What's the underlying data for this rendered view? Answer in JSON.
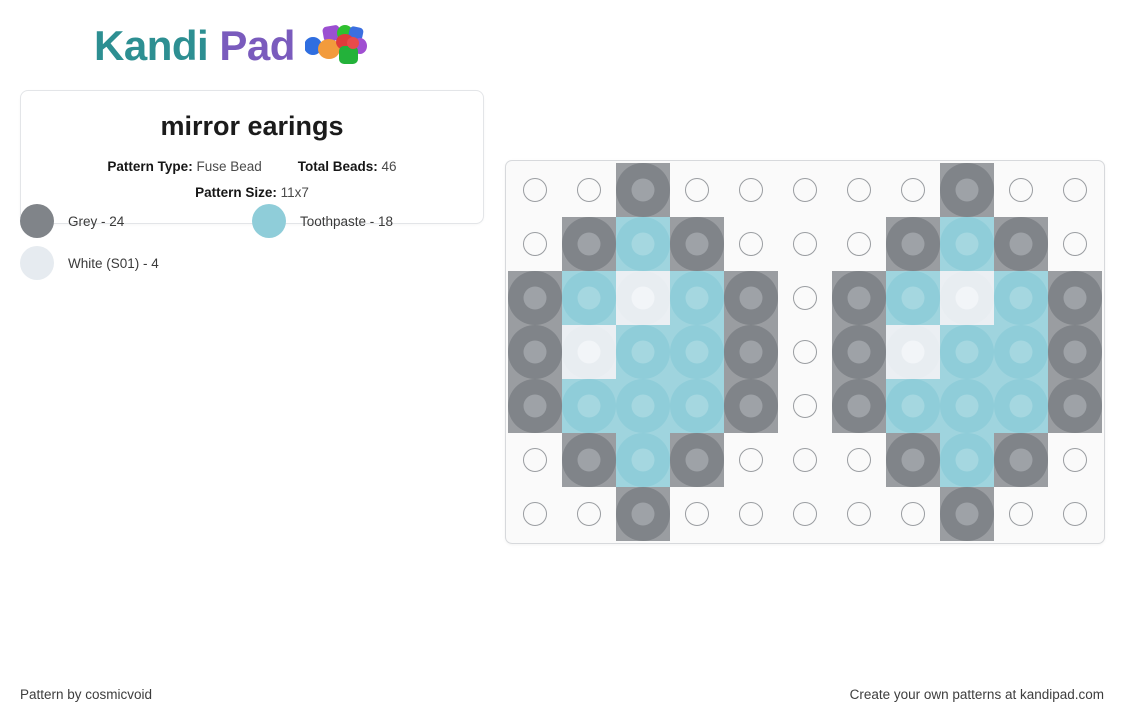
{
  "brand": {
    "name_part1": "Kandi",
    "name_part2": "Pad",
    "beads_icon": "kandi-beads-icon",
    "color_teal": "#2d8f92",
    "color_purple": "#7a5bbd"
  },
  "pattern": {
    "title": "mirror earings",
    "type_label": "Pattern Type:",
    "type_value": "Fuse Bead",
    "total_label": "Total Beads:",
    "total_value": "46",
    "size_label": "Pattern Size:",
    "size_value": "11x7"
  },
  "legend": {
    "items": [
      {
        "name": "Grey",
        "count": 24,
        "label": "Grey - 24",
        "color": "#808489"
      },
      {
        "name": "Toothpaste",
        "count": 18,
        "label": "Toothpaste - 18",
        "color": "#8fcdd9"
      },
      {
        "name": "White (S01)",
        "count": 4,
        "label": "White (S01) - 4",
        "color": "#e6ebf0"
      }
    ]
  },
  "grid": {
    "columns": 11,
    "rows": 7,
    "palette": {
      "G": {
        "key": "G",
        "name": "Grey",
        "fill": "#808489",
        "hole": "#9ea2a7",
        "tint": "#9a9da1"
      },
      "T": {
        "key": "T",
        "name": "Toothpaste",
        "fill": "#8fcdd9",
        "hole": "#a5d7e0",
        "tint": "#9fd4de"
      },
      "W": {
        "key": "W",
        "name": "White (S01)",
        "fill": "#e8edf1",
        "hole": "#f2f5f8",
        "tint": "#ebeff3"
      },
      "_": {
        "key": "_",
        "name": "empty",
        "fill": null,
        "hole": null,
        "tint": null
      }
    },
    "cells": [
      [
        "_",
        "_",
        "G",
        "_",
        "_",
        "_",
        "_",
        "_",
        "G",
        "_",
        "_"
      ],
      [
        "_",
        "G",
        "T",
        "G",
        "_",
        "_",
        "_",
        "G",
        "T",
        "G",
        "_"
      ],
      [
        "G",
        "T",
        "W",
        "T",
        "G",
        "_",
        "G",
        "T",
        "W",
        "T",
        "G"
      ],
      [
        "G",
        "W",
        "T",
        "T",
        "G",
        "_",
        "G",
        "W",
        "T",
        "T",
        "G"
      ],
      [
        "G",
        "T",
        "T",
        "T",
        "G",
        "_",
        "G",
        "T",
        "T",
        "T",
        "G"
      ],
      [
        "_",
        "G",
        "T",
        "G",
        "_",
        "_",
        "_",
        "G",
        "T",
        "G",
        "_"
      ],
      [
        "_",
        "_",
        "G",
        "_",
        "_",
        "_",
        "_",
        "_",
        "G",
        "_",
        "_"
      ]
    ]
  },
  "footer": {
    "credit": "Pattern by cosmicvoid",
    "promo": "Create your own patterns at kandipad.com"
  }
}
